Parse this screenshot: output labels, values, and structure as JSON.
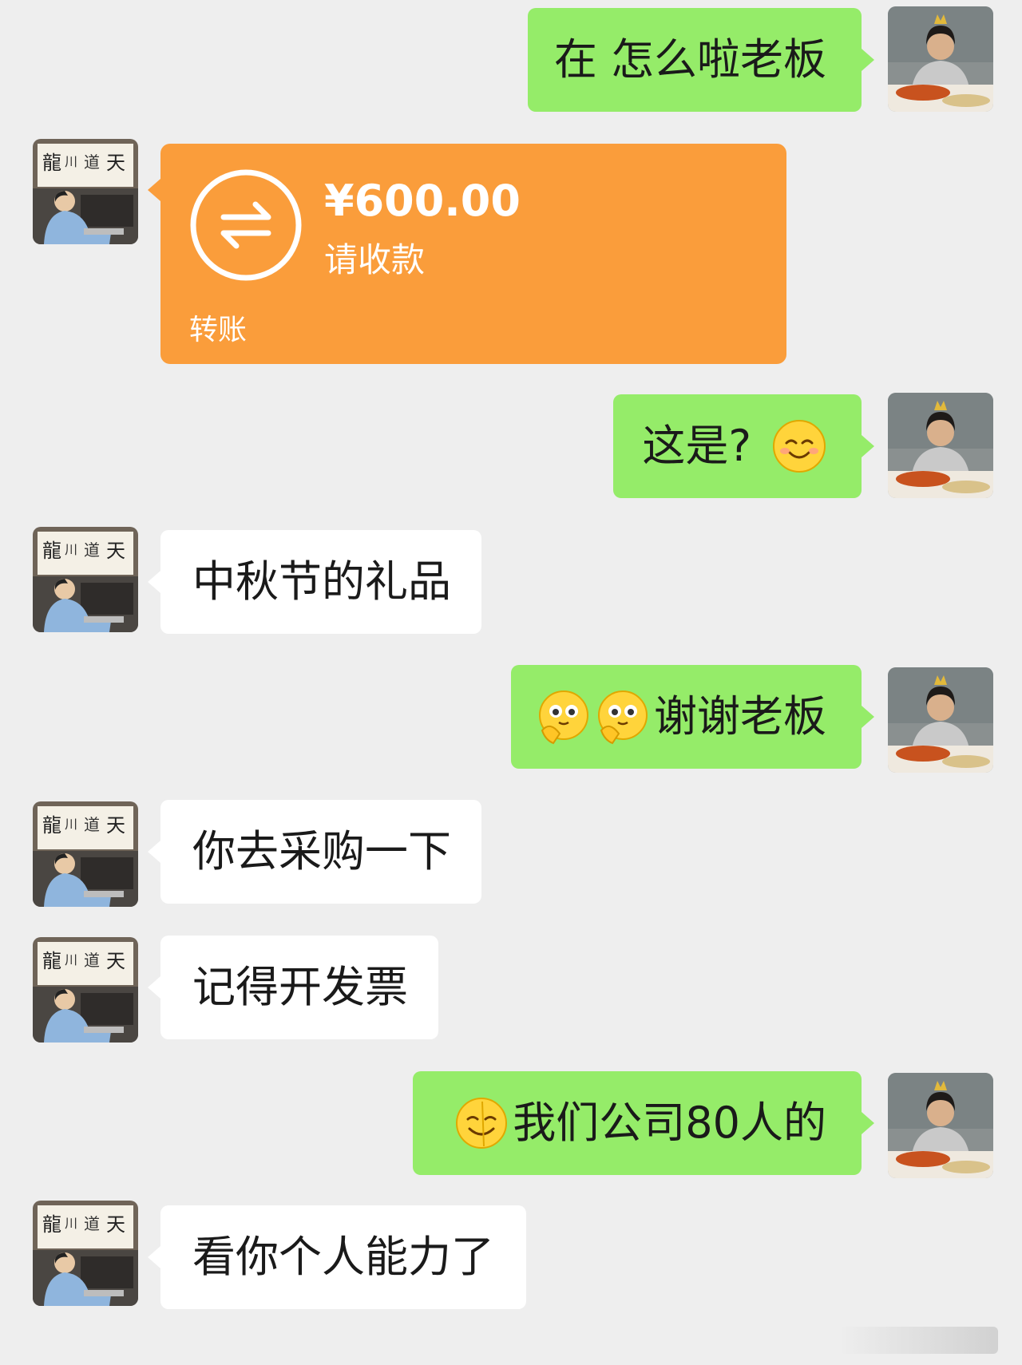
{
  "chat": {
    "messages": [
      {
        "sender": "me",
        "text": "在 怎么啦老板"
      },
      {
        "sender": "boss",
        "type": "transfer",
        "amount": "¥600.00",
        "note": "请收款",
        "label": "转账"
      },
      {
        "sender": "me",
        "text": "这是?",
        "emoji": "smiling-blush-emoji"
      },
      {
        "sender": "boss",
        "text": "中秋节的礼品"
      },
      {
        "sender": "me",
        "text": "谢谢老板",
        "emoji": "clasped-hands-emoji"
      },
      {
        "sender": "boss",
        "text": "你去采购一下"
      },
      {
        "sender": "boss",
        "text": "记得开发票"
      },
      {
        "sender": "me",
        "text": "我们公司80人的",
        "emoji": "sweat-smile-emoji"
      },
      {
        "sender": "boss",
        "text": "看你个人能力了"
      }
    ]
  },
  "colors": {
    "background": "#eeeeee",
    "my_bubble": "#95ec69",
    "their_bubble": "#ffffff",
    "transfer_card": "#fa9d3b"
  }
}
